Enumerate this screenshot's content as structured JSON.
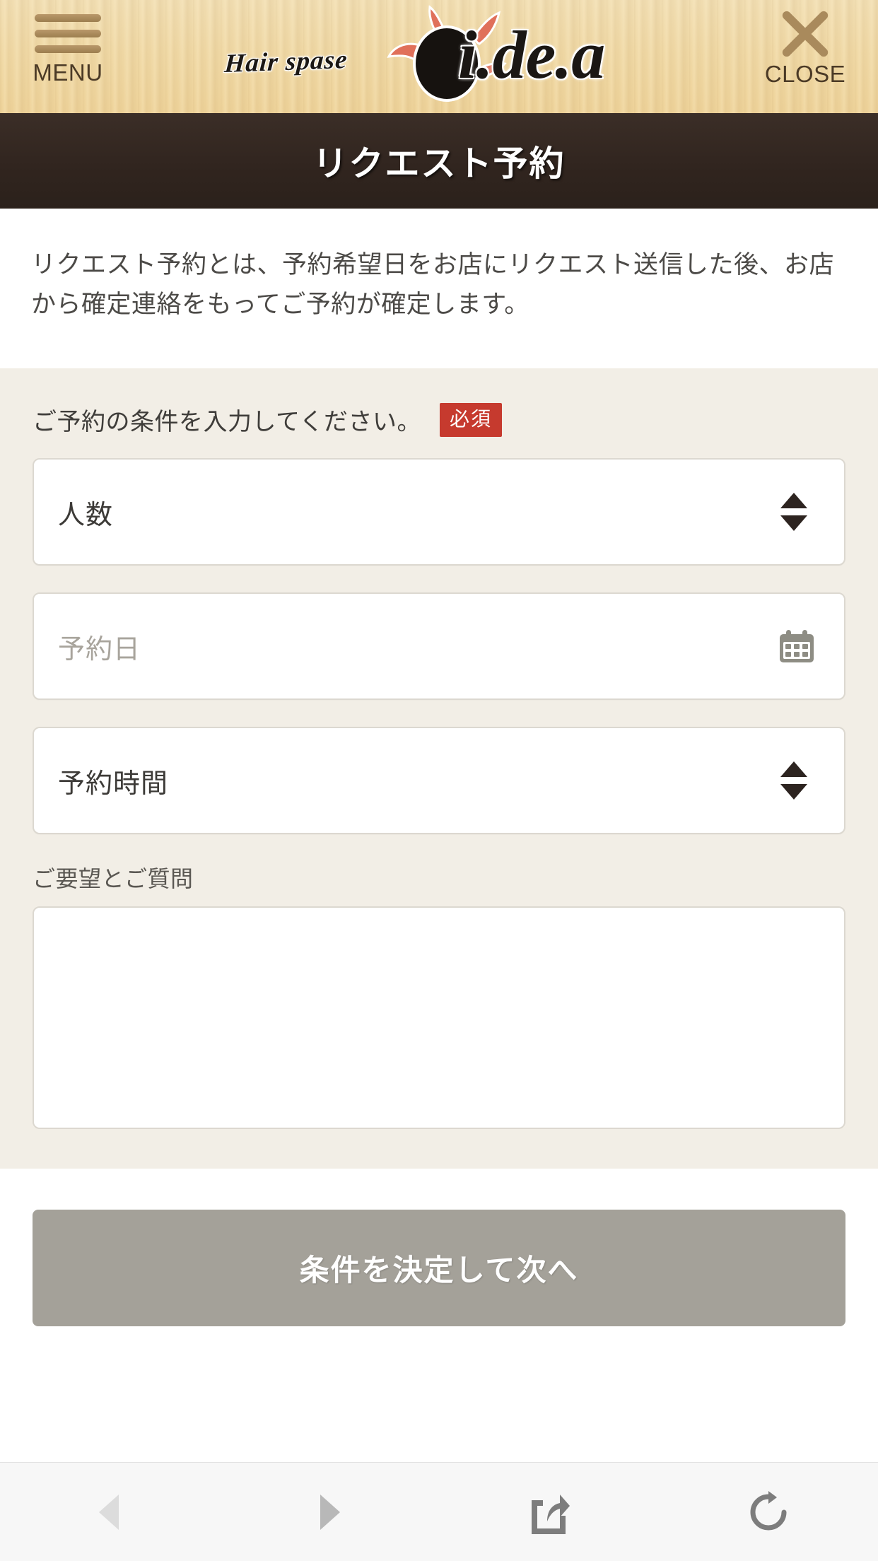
{
  "topbar": {
    "menu_label": "MENU",
    "close_label": "CLOSE",
    "logo_script": "Hair spase",
    "logo_word": "i.de.a",
    "wood_color": "#f0d9a6",
    "accent_color": "#e0705a"
  },
  "title": {
    "text": "リクエスト予約",
    "bar_color": "#31251f"
  },
  "intro": {
    "text": "リクエスト予約とは、予約希望日をお店にリクエスト送信した後、お店から確定連絡をもってご予約が確定します。"
  },
  "form": {
    "section_label": "ご予約の条件を入力してください。",
    "required_badge": "必須",
    "required_badge_color": "#c63a2e",
    "fields": [
      {
        "name": "people",
        "value": "人数",
        "is_placeholder": false,
        "control": "select"
      },
      {
        "name": "date",
        "value": "予約日",
        "is_placeholder": true,
        "control": "date"
      },
      {
        "name": "time",
        "value": "予約時間",
        "is_placeholder": false,
        "control": "select"
      }
    ],
    "textarea_label": "ご要望とご質問",
    "textarea_value": "",
    "textarea_placeholder": ""
  },
  "submit": {
    "label": "条件を決定して次へ",
    "color": "#a4a199"
  },
  "browser_toolbar": {
    "items": [
      {
        "name": "back",
        "icon": "back-arrow-icon",
        "enabled": false
      },
      {
        "name": "forward",
        "icon": "forward-arrow-icon",
        "enabled": true
      },
      {
        "name": "share",
        "icon": "share-icon",
        "enabled": true
      },
      {
        "name": "reload",
        "icon": "reload-icon",
        "enabled": true
      }
    ]
  }
}
